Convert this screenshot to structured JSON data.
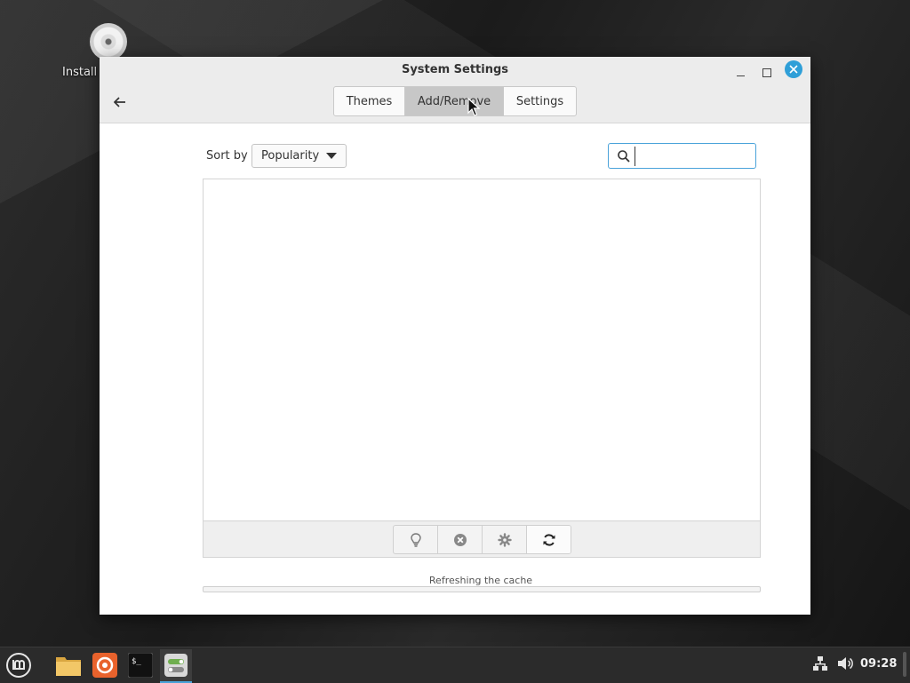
{
  "desktop": {
    "icons": [
      {
        "label": "Install",
        "icon": "disc-icon"
      }
    ]
  },
  "window": {
    "title": "System Settings",
    "controls": {
      "minimize": "minimize-icon",
      "maximize": "maximize-icon",
      "close": "close-icon"
    },
    "tabs": [
      {
        "label": "Themes",
        "active": false
      },
      {
        "label": "Add/Remove",
        "active": true
      },
      {
        "label": "Settings",
        "active": false
      }
    ]
  },
  "content": {
    "sort_label": "Sort by",
    "sort_value": "Popularity",
    "search": {
      "value": "",
      "placeholder": ""
    },
    "toolbar_icons": [
      "info-icon",
      "uninstall-icon",
      "configure-icon",
      "refresh-icon"
    ],
    "status": "Refreshing the cache",
    "progress": 0
  },
  "taskbar": {
    "apps": [
      "menu-icon",
      "files-icon",
      "firefox-icon",
      "terminal-icon",
      "settings-icon"
    ],
    "clock": "09:28"
  },
  "colors": {
    "accent": "#2f9fd8",
    "selected_tab": "#c7c7c7",
    "header_bg": "#ececec"
  }
}
